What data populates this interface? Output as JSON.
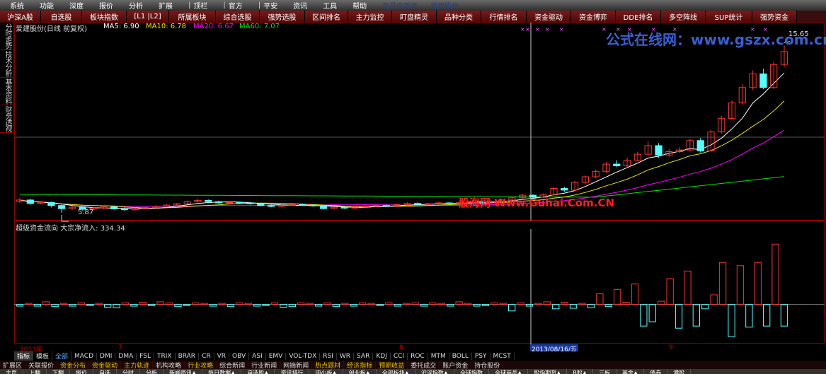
{
  "menu": {
    "items": [
      "系统",
      "功能",
      "深度",
      "报价",
      "分析",
      "扩展",
      "资讯",
      "工具",
      "帮助"
    ],
    "items_b": [
      "顶栏",
      "官方",
      "平安"
    ],
    "faded": [
      "交易中首平",
      "爱建股份"
    ]
  },
  "top_tabs": [
    {
      "label": "沪深A股",
      "w": 58
    },
    {
      "label": "自选股",
      "w": 58
    },
    {
      "label": "板块指数",
      "w": 63
    },
    {
      "label": "[L1 |L2]",
      "w": 60
    },
    {
      "label": "所属板块",
      "w": 66
    },
    {
      "label": "综合选股",
      "w": 62
    },
    {
      "label": "强势选股",
      "w": 64
    },
    {
      "label": "区间排名",
      "w": 61
    },
    {
      "label": "主力监控",
      "w": 62
    },
    {
      "label": "盯盘精灵",
      "w": 63
    },
    {
      "label": "品种分类",
      "w": 63
    },
    {
      "label": "行情排名",
      "w": 64
    },
    {
      "label": "资金驱动",
      "w": 63
    },
    {
      "label": "资金博弈",
      "w": 63
    },
    {
      "label": "DDE排名",
      "w": 64
    },
    {
      "label": "多空阵线",
      "w": 63
    },
    {
      "label": "SUP统计",
      "w": 66
    },
    {
      "label": "强势资金",
      "w": 63
    }
  ],
  "side_tabs": [
    "分时走势",
    "技术分析",
    "基本资料",
    "财务透视"
  ],
  "price_panel": {
    "stock_name": "爱建股份(日线 前复权)",
    "ma5_label": "MA5:",
    "ma5": "6.90",
    "ma10_label": "MA10:",
    "ma10": "6.78",
    "ma20_label": "MA20:",
    "ma20": "6.67",
    "ma60_label": "MA60:",
    "ma60": "7.07",
    "high_label": "15.65",
    "low_label": "5.87"
  },
  "flow_panel": {
    "title": "超级资金流向",
    "net_label": "大宗净流入:",
    "net_value": "334.34"
  },
  "watermarks": {
    "top": "公式在线网：www.gszx.com.cn",
    "middle": "股海网 Www.Guhai.Com.CN"
  },
  "time_axis": {
    "labels": [
      "2013年",
      "7",
      "8",
      "9"
    ],
    "cursor": "2013/08/16/五"
  },
  "index_tabs": [
    "指标",
    "模板",
    "全部",
    "MACD",
    "DMI",
    "DMA",
    "FSL",
    "TRIX",
    "BRAR",
    "CR",
    "VR",
    "OBV",
    "ASI",
    "EMV",
    "VOL-TDX",
    "RSI",
    "WR",
    "SAR",
    "KDJ",
    "CCI",
    "ROC",
    "MTM",
    "BOLL",
    "PSY",
    "MCST"
  ],
  "info_tabs": [
    "扩展区",
    "关联报价",
    "资金分布",
    "资金驱动",
    "主力轨迹",
    "机构攻略",
    "行业攻略",
    "综合新闻",
    "行业新闻",
    "网摘新闻",
    "热点题材",
    "经济指标",
    "预期收益",
    "委托成交",
    "账户资金",
    "持仓股份"
  ],
  "bottom_tabs": [
    "主页",
    "上翻",
    "下翻",
    "报价",
    "自选",
    "分时",
    "分析",
    "新闻资讯▲",
    "每日数据▲",
    "自选股▲",
    "资讯排行",
    "中小板▲",
    "创业板▲",
    "全部板块▲",
    "沪深指数▲",
    "全球指数",
    "全球商品▲",
    "股指期货▲",
    "B股▲",
    "三板",
    "基金▲",
    "债券",
    "港股"
  ],
  "colors": {
    "up": "#ff3232",
    "down": "#54ffff",
    "ma5": "#ffffff",
    "ma10": "#e6e600",
    "ma20": "#ff00ff",
    "ma60": "#00e600",
    "grid": "#8b0000"
  },
  "chart_data": {
    "type": "candlestick",
    "series_desc": "daily price candles (open, close, high, low) + super fund flow bars",
    "candles": [
      [
        6.55,
        6.62,
        6.75,
        6.45
      ],
      [
        6.62,
        6.42,
        6.7,
        6.35
      ],
      [
        6.42,
        6.48,
        6.55,
        6.38
      ],
      [
        6.48,
        6.3,
        6.52,
        6.18
      ],
      [
        6.3,
        6.12,
        6.35,
        5.87
      ],
      [
        6.12,
        6.2,
        6.28,
        6.05
      ],
      [
        6.2,
        6.08,
        6.25,
        6.0
      ],
      [
        6.08,
        6.15,
        6.22,
        6.02
      ],
      [
        6.15,
        6.22,
        6.3,
        6.1
      ],
      [
        6.22,
        6.1,
        6.28,
        6.05
      ],
      [
        6.1,
        6.05,
        6.18,
        6.0
      ],
      [
        6.05,
        6.12,
        6.2,
        6.0
      ],
      [
        6.12,
        6.18,
        6.25,
        6.08
      ],
      [
        6.18,
        6.25,
        6.32,
        6.12
      ],
      [
        6.25,
        6.32,
        6.4,
        6.2
      ],
      [
        6.32,
        6.4,
        6.45,
        6.25
      ],
      [
        6.4,
        6.52,
        6.58,
        6.35
      ],
      [
        6.52,
        6.6,
        6.68,
        6.45
      ],
      [
        6.6,
        6.52,
        6.65,
        6.45
      ],
      [
        6.52,
        6.45,
        6.58,
        6.4
      ],
      [
        6.45,
        6.48,
        6.55,
        6.38
      ],
      [
        6.48,
        6.44,
        6.52,
        6.38
      ],
      [
        6.44,
        6.4,
        6.5,
        6.35
      ],
      [
        6.4,
        6.3,
        6.46,
        6.25
      ],
      [
        6.3,
        6.25,
        6.36,
        6.2
      ],
      [
        6.25,
        6.3,
        6.36,
        6.2
      ],
      [
        6.3,
        6.35,
        6.4,
        6.25
      ],
      [
        6.35,
        6.32,
        6.42,
        6.28
      ],
      [
        6.32,
        6.28,
        6.38,
        6.22
      ],
      [
        6.28,
        6.12,
        6.3,
        6.08
      ],
      [
        6.12,
        6.2,
        6.25,
        6.08
      ],
      [
        6.2,
        6.15,
        6.25,
        6.1
      ],
      [
        6.15,
        6.22,
        6.28,
        6.1
      ],
      [
        6.22,
        6.26,
        6.3,
        6.18
      ],
      [
        6.26,
        6.3,
        6.36,
        6.2
      ],
      [
        6.3,
        6.28,
        6.35,
        6.22
      ],
      [
        6.28,
        6.35,
        6.4,
        6.25
      ],
      [
        6.35,
        6.42,
        6.48,
        6.3
      ],
      [
        6.42,
        6.38,
        6.48,
        6.32
      ],
      [
        6.38,
        6.4,
        6.45,
        6.32
      ],
      [
        6.4,
        6.45,
        6.52,
        6.35
      ],
      [
        6.45,
        6.42,
        6.5,
        6.38
      ],
      [
        6.42,
        6.48,
        6.55,
        6.38
      ],
      [
        6.48,
        6.52,
        6.58,
        6.42
      ],
      [
        6.52,
        6.45,
        6.58,
        6.4
      ],
      [
        6.45,
        6.55,
        6.62,
        6.4
      ],
      [
        6.55,
        6.62,
        6.7,
        6.5
      ],
      [
        6.62,
        6.75,
        6.82,
        6.58
      ],
      [
        6.75,
        6.9,
        6.98,
        6.7
      ],
      [
        6.9,
        6.78,
        6.95,
        6.7
      ],
      [
        6.78,
        6.92,
        7.0,
        6.72
      ],
      [
        6.92,
        7.3,
        7.38,
        6.88
      ],
      [
        7.3,
        7.2,
        7.4,
        7.1
      ],
      [
        7.2,
        7.65,
        7.75,
        7.15
      ],
      [
        7.65,
        7.98,
        8.05,
        7.55
      ],
      [
        7.98,
        8.3,
        8.4,
        7.9
      ],
      [
        8.3,
        8.72,
        8.85,
        8.2
      ],
      [
        8.72,
        8.62,
        8.95,
        8.55
      ],
      [
        8.62,
        8.95,
        9.1,
        8.55
      ],
      [
        8.95,
        9.3,
        9.45,
        8.9
      ],
      [
        9.3,
        9.8,
        10.05,
        9.25
      ],
      [
        9.8,
        9.25,
        9.95,
        9.1
      ],
      [
        9.25,
        9.45,
        9.6,
        9.15
      ],
      [
        9.45,
        9.55,
        9.7,
        9.35
      ],
      [
        9.55,
        10.1,
        10.2,
        9.45
      ],
      [
        10.1,
        9.5,
        10.25,
        9.4
      ],
      [
        9.5,
        10.6,
        10.75,
        9.45
      ],
      [
        10.6,
        11.4,
        11.55,
        10.5
      ],
      [
        11.4,
        12.3,
        12.45,
        11.3
      ],
      [
        12.3,
        13.2,
        13.4,
        12.2
      ],
      [
        13.2,
        14.0,
        14.2,
        13.05
      ],
      [
        14.0,
        13.2,
        14.3,
        13.1
      ],
      [
        13.2,
        14.55,
        14.7,
        13.1
      ],
      [
        14.55,
        15.3,
        15.65,
        14.4
      ]
    ],
    "flow": [
      -3,
      2,
      -3,
      5,
      -4,
      2,
      -3,
      3,
      -2,
      2,
      -5,
      -6,
      3,
      -3,
      4,
      -2,
      5,
      3,
      -4,
      -2,
      3,
      2,
      -3,
      2,
      -4,
      3,
      2,
      -3,
      -2,
      3,
      -5,
      -4,
      3,
      2,
      -3,
      3,
      -4,
      2,
      -3,
      3,
      2,
      -2,
      3,
      -3,
      2,
      3,
      -3,
      3,
      2,
      -3,
      5,
      2,
      -3,
      -2,
      3,
      2,
      -12,
      3,
      -3,
      2,
      5,
      -8,
      4,
      -7,
      2,
      -6,
      20,
      -4,
      28,
      4,
      38,
      -40,
      -32,
      6,
      48,
      -44,
      62,
      -40,
      -8,
      18,
      78,
      -60,
      72,
      -42,
      78,
      -40,
      112,
      -40
    ],
    "price_range": [
      5.5,
      16.5
    ],
    "flow_range": [
      -70,
      140
    ]
  }
}
